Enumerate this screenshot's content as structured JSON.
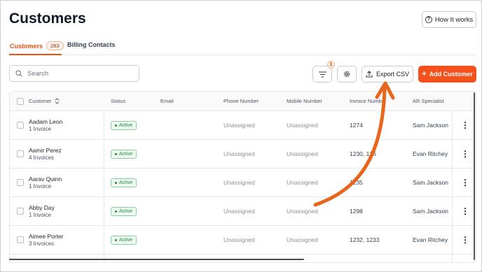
{
  "header": {
    "title": "Customers",
    "how_it_works": "How It works"
  },
  "tabs": [
    {
      "label": "Customers",
      "count": "283",
      "active": true
    },
    {
      "label": "Billing Contacts",
      "active": false
    }
  ],
  "toolbar": {
    "search_placeholder": "Search",
    "filter_count": "1",
    "export_label": "Export CSV",
    "add_label": "Add Customer"
  },
  "table": {
    "columns": [
      "Customer",
      "Status",
      "Email",
      "Phone Number",
      "Mobile Number",
      "Invoice Number",
      "AR Specialist"
    ],
    "rows": [
      {
        "name": "Aadam Leon",
        "invoices": "1 Invoice",
        "status": "Active",
        "email": "",
        "phone": "Unassigned",
        "mobile": "Unassigned",
        "invoice_number": "1274",
        "ar_specialist": "Sam Jackson"
      },
      {
        "name": "Aamir Perez",
        "invoices": "4 Invoices",
        "status": "Active",
        "email": "",
        "phone": "Unassigned",
        "mobile": "Unassigned",
        "invoice_number": "1230, 126",
        "ar_specialist": "Evan Ritchey"
      },
      {
        "name": "Aarav Quinn",
        "invoices": "1 Invoice",
        "status": "Active",
        "email": "",
        "phone": "Unassigned",
        "mobile": "Unassigned",
        "invoice_number": "1235",
        "ar_specialist": "Sam Jackson"
      },
      {
        "name": "Abby Day",
        "invoices": "1 Invoice",
        "status": "Active",
        "email": "",
        "phone": "Unassigned",
        "mobile": "Unassigned",
        "invoice_number": "1298",
        "ar_specialist": "Sam Jackson"
      },
      {
        "name": "Aimee Porter",
        "invoices": "3 Invoices",
        "status": "Active",
        "email": "",
        "phone": "Unassigned",
        "mobile": "Unassigned",
        "invoice_number": "1232, 1233",
        "ar_specialist": "Evan Ritchey"
      }
    ]
  },
  "icons": {
    "help": "question-circle-icon",
    "search": "search-icon",
    "filter": "filter-lines-icon",
    "settings": "gear-icon",
    "export": "upload-icon",
    "add": "plus-icon",
    "sort": "sort-icon",
    "row_menu": "kebab-menu-icon"
  },
  "colors": {
    "accent": "#f4511e",
    "active_badge": "#1f8a3f",
    "annotation_arrow": "#e8651a"
  }
}
